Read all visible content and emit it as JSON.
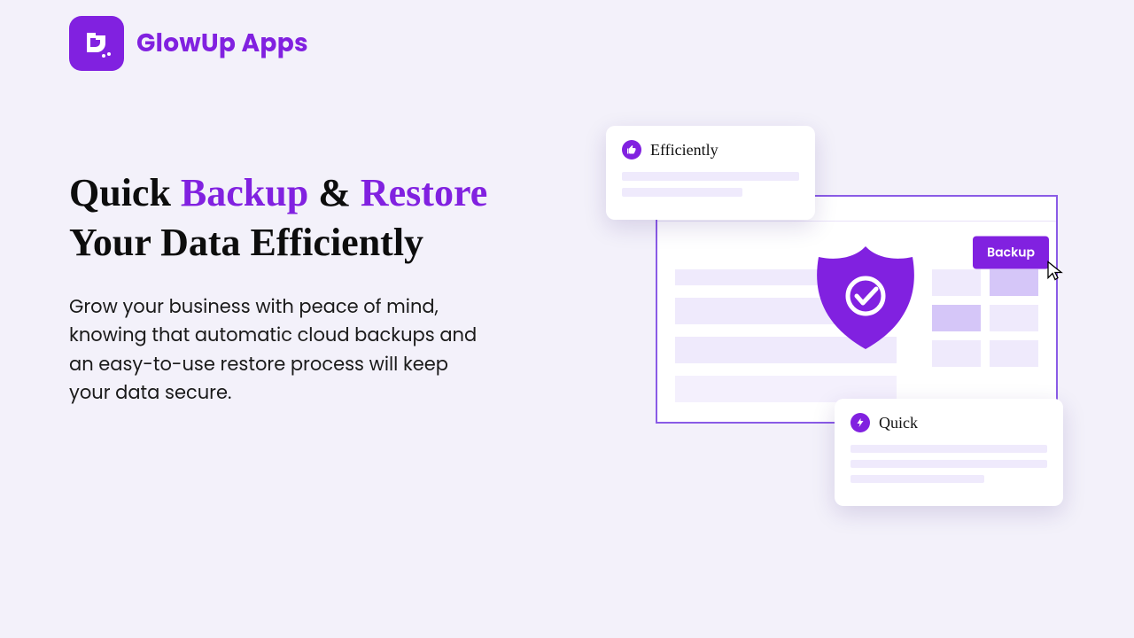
{
  "brand": {
    "name": "GlowUp Apps",
    "accent_color": "#8121e0"
  },
  "hero": {
    "title_plain_1": "Quick ",
    "title_accent_1": "Backup",
    "title_plain_2": " & ",
    "title_accent_2": "Restore",
    "title_plain_3": " Your Data Efficiently",
    "subtitle": "Grow your business with peace of mind, knowing that automatic cloud backups and an easy-to-use restore process will keep your data secure."
  },
  "illustration": {
    "backup_button_label": "Backup",
    "card_efficiently": {
      "label": "Efficiently"
    },
    "card_quick": {
      "label": "Quick"
    }
  }
}
